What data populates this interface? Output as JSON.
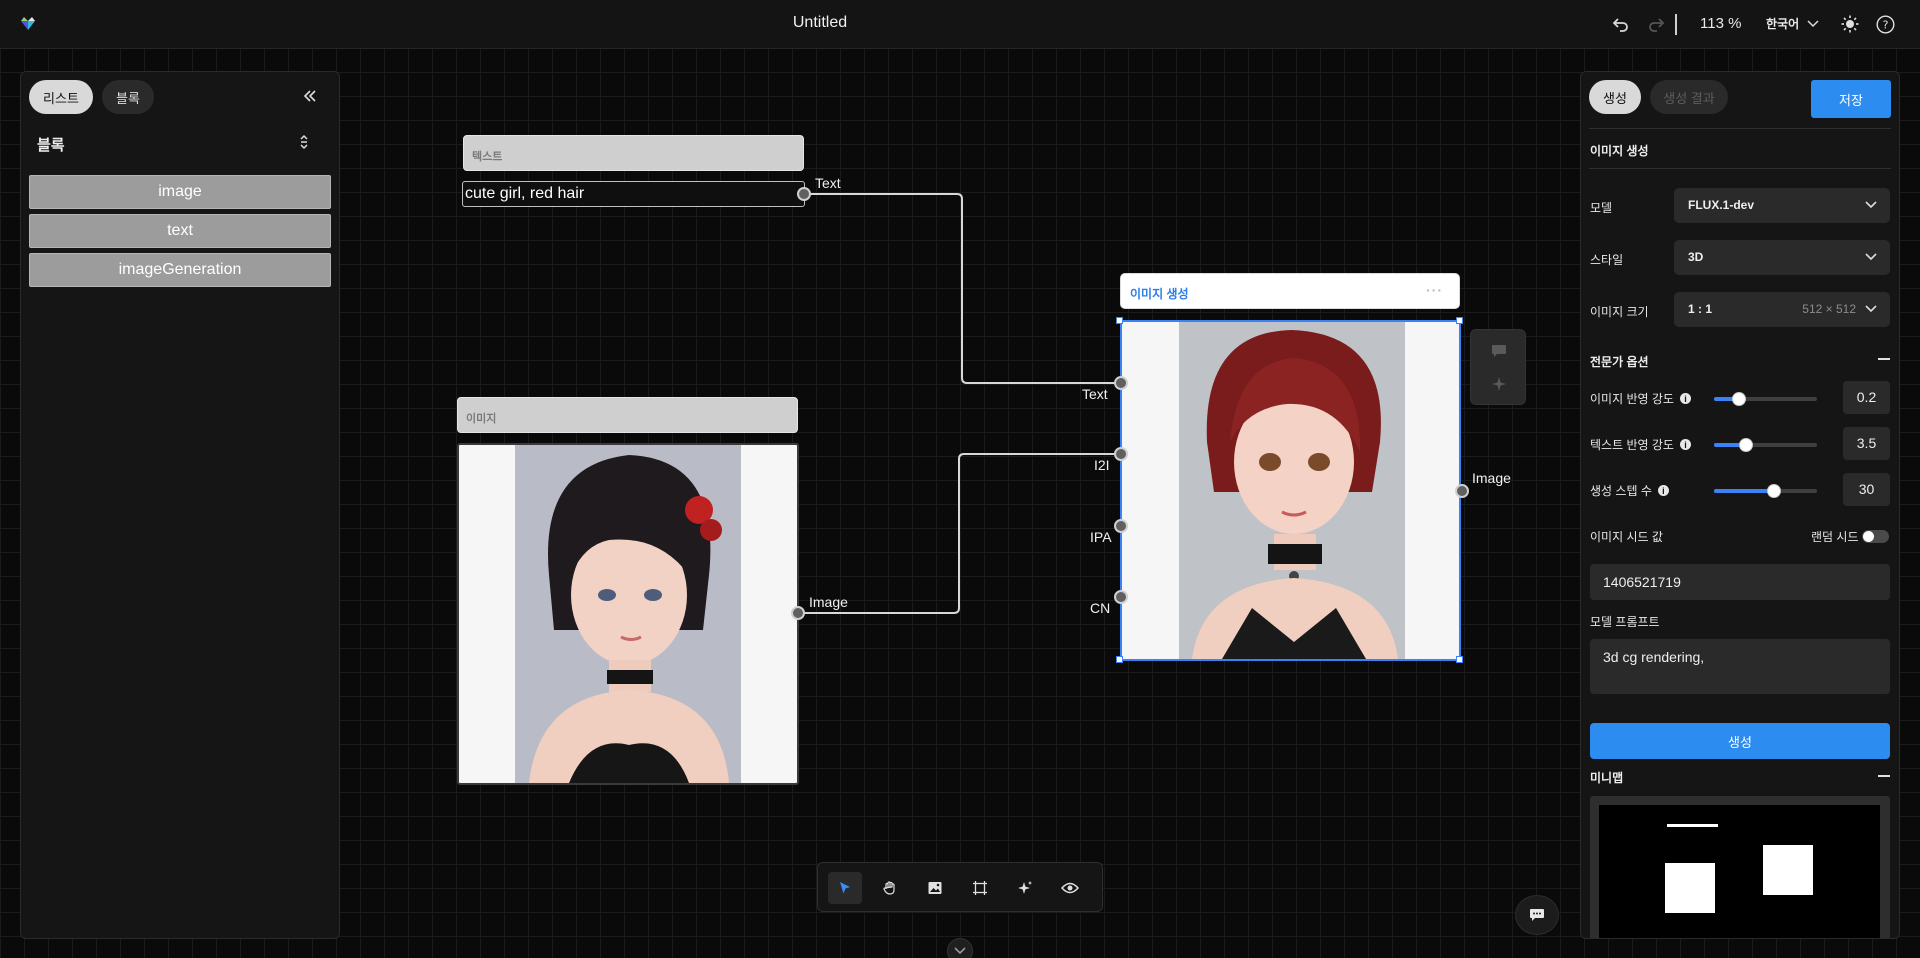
{
  "app": {
    "title": "Untitled",
    "zoom": "113 %",
    "language": "한국어"
  },
  "icons": {
    "logo": "logo-icon",
    "undo": "undo-icon",
    "redo": "redo-icon",
    "theme": "sun-icon",
    "help": "help-icon"
  },
  "left_panel": {
    "tabs": [
      {
        "label": "리스트",
        "active": true
      },
      {
        "label": "블록",
        "active": false
      }
    ],
    "section_title": "블록",
    "items": [
      "image",
      "text",
      "imageGeneration"
    ]
  },
  "canvas": {
    "text_node": {
      "header": "텍스트",
      "value": "cute girl, red hair",
      "output_label": "Text"
    },
    "image_node": {
      "header": "이미지",
      "output_label": "Image"
    },
    "gen_node": {
      "header": "이미지 생성",
      "menu": "···",
      "inputs": [
        "Text",
        "I2I",
        "IPA",
        "CN"
      ],
      "output_label": "Image"
    }
  },
  "right_panel": {
    "tabs": [
      {
        "label": "생성",
        "active": true
      },
      {
        "label": "생성 결과",
        "active": false
      }
    ],
    "save_label": "저장",
    "section_title": "이미지 생성",
    "model": {
      "label": "모델",
      "value": "FLUX.1-dev"
    },
    "style": {
      "label": "스타일",
      "value": "3D"
    },
    "size": {
      "label": "이미지 크기",
      "ratio": "1 : 1",
      "dims": "512 × 512"
    },
    "expert": {
      "title": "전문가 옵션",
      "sliders": [
        {
          "label": "이미지 반영 강도",
          "value": "0.2",
          "fraction": 0.24
        },
        {
          "label": "텍스트 반영 강도",
          "value": "3.5",
          "fraction": 0.31
        },
        {
          "label": "생성 스텝 수",
          "value": "30",
          "fraction": 0.58
        }
      ]
    },
    "seed": {
      "label": "이미지 시드 값",
      "random_label": "랜덤 시드",
      "random_on": false,
      "value": "1406521719"
    },
    "prompt": {
      "label": "모델 프롬프트",
      "value": "3d cg rendering,"
    },
    "generate_label": "생성",
    "minimap_title": "미니맵"
  },
  "colors": {
    "accent": "#2d8cf0",
    "selection": "#3b82f6",
    "background": "#0a0a0a"
  }
}
